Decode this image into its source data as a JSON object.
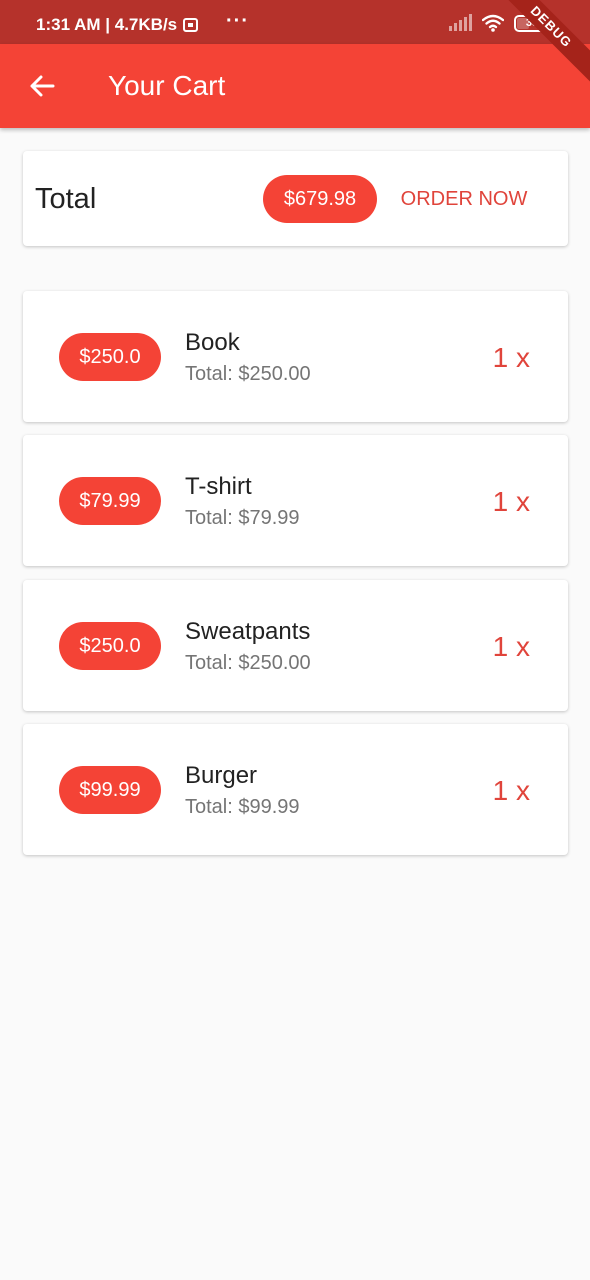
{
  "status_bar": {
    "time_speed": "1:31 AM | 4.7KB/s",
    "more": "···",
    "battery": "38"
  },
  "debug_banner": "DEBUG",
  "app_bar": {
    "title": "Your Cart"
  },
  "summary": {
    "label": "Total",
    "amount": "$679.98",
    "order_button": "ORDER NOW"
  },
  "items": [
    {
      "chip": "$250.0",
      "title": "Book",
      "subtitle": "Total: $250.00",
      "quantity": "1 x"
    },
    {
      "chip": "$79.99",
      "title": "T-shirt",
      "subtitle": "Total: $79.99",
      "quantity": "1 x"
    },
    {
      "chip": "$250.0",
      "title": "Sweatpants",
      "subtitle": "Total: $250.00",
      "quantity": "1 x"
    },
    {
      "chip": "$99.99",
      "title": "Burger",
      "subtitle": "Total: $99.99",
      "quantity": "1 x"
    }
  ],
  "colors": {
    "primary": "#f44336",
    "status_bar": "#b5322b",
    "accent_text": "#e0443b"
  }
}
